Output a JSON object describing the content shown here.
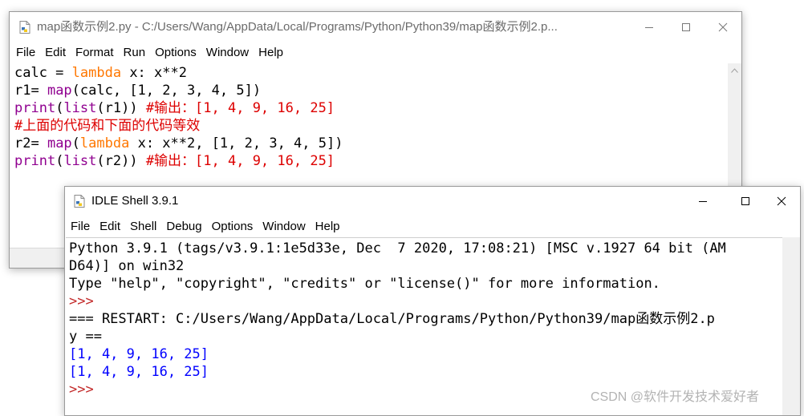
{
  "editor": {
    "title": "map函数示例2.py - C:/Users/Wang/AppData/Local/Programs/Python/Python39/map函数示例2.p...",
    "menu": [
      "File",
      "Edit",
      "Format",
      "Run",
      "Options",
      "Window",
      "Help"
    ],
    "lines": [
      [
        {
          "t": "calc = ",
          "c": "df"
        },
        {
          "t": "lambda",
          "c": "kw"
        },
        {
          "t": " x: x**2",
          "c": "df"
        }
      ],
      [
        {
          "t": "r1= ",
          "c": "df"
        },
        {
          "t": "map",
          "c": "bi"
        },
        {
          "t": "(calc, [1, 2, 3, 4, 5])",
          "c": "df"
        }
      ],
      [
        {
          "t": "print",
          "c": "bi"
        },
        {
          "t": "(",
          "c": "df"
        },
        {
          "t": "list",
          "c": "bi"
        },
        {
          "t": "(r1)) ",
          "c": "df"
        },
        {
          "t": "#输出：[1, 4, 9, 16, 25]",
          "c": "cm"
        }
      ],
      [
        {
          "t": "#上面的代码和下面的代码等效",
          "c": "cm"
        }
      ],
      [
        {
          "t": "r2= ",
          "c": "df"
        },
        {
          "t": "map",
          "c": "bi"
        },
        {
          "t": "(",
          "c": "df"
        },
        {
          "t": "lambda",
          "c": "kw"
        },
        {
          "t": " x: x**2, [1, 2, 3, 4, 5])",
          "c": "df"
        }
      ],
      [
        {
          "t": "print",
          "c": "bi"
        },
        {
          "t": "(",
          "c": "df"
        },
        {
          "t": "list",
          "c": "bi"
        },
        {
          "t": "(r2)) ",
          "c": "df"
        },
        {
          "t": "#输出：[1, 4, 9, 16, 25]",
          "c": "cm"
        }
      ]
    ]
  },
  "shell": {
    "title": "IDLE Shell 3.9.1",
    "menu": [
      "File",
      "Edit",
      "Shell",
      "Debug",
      "Options",
      "Window",
      "Help"
    ],
    "lines": [
      [
        {
          "t": "Python 3.9.1 (tags/v3.9.1:1e5d33e, Dec  7 2020, 17:08:21) [MSC v.1927 64 bit (AM",
          "c": "df"
        }
      ],
      [
        {
          "t": "D64)] on win32",
          "c": "df"
        }
      ],
      [
        {
          "t": "Type \"help\", \"copyright\", \"credits\" or \"license()\" for more information.",
          "c": "df"
        }
      ],
      [
        {
          "t": ">>>",
          "c": "pr"
        }
      ],
      [
        {
          "t": "=== RESTART: C:/Users/Wang/AppData/Local/Programs/Python/Python39/map函数示例2.p",
          "c": "df"
        }
      ],
      [
        {
          "t": "y ==",
          "c": "df"
        }
      ],
      [
        {
          "t": "[1, 4, 9, 16, 25]",
          "c": "out"
        }
      ],
      [
        {
          "t": "[1, 4, 9, 16, 25]",
          "c": "out"
        }
      ],
      [
        {
          "t": ">>>",
          "c": "pr"
        }
      ]
    ]
  },
  "watermark": "CSDN @软件开发技术爱好者"
}
